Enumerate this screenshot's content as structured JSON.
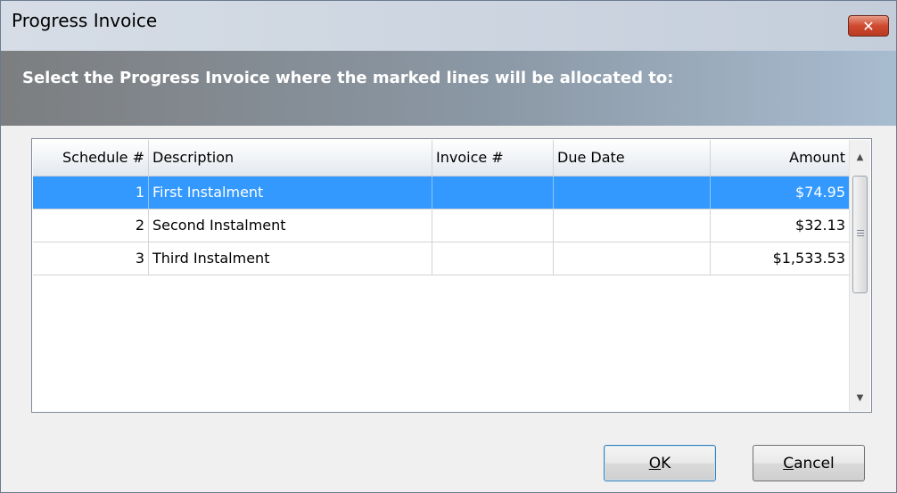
{
  "window": {
    "title": "Progress Invoice",
    "close_icon": "close-x-icon"
  },
  "banner": {
    "text": "Select the Progress Invoice where the marked lines will be allocated to:"
  },
  "table": {
    "columns": [
      "Schedule #",
      "Description",
      "Invoice #",
      "Due Date",
      "Amount"
    ],
    "rows": [
      {
        "schedule": "1",
        "description": "First Instalment",
        "invoice": "",
        "due_date": "",
        "amount": "$74.95",
        "selected": true
      },
      {
        "schedule": "2",
        "description": "Second Instalment",
        "invoice": "",
        "due_date": "",
        "amount": "$32.13",
        "selected": false
      },
      {
        "schedule": "3",
        "description": "Third Instalment",
        "invoice": "",
        "due_date": "",
        "amount": "$1,533.53",
        "selected": false
      }
    ]
  },
  "buttons": {
    "ok_mnemonic": "O",
    "ok_rest": "K",
    "cancel_mnemonic": "C",
    "cancel_rest": "ancel"
  },
  "colors": {
    "selection": "#3399ff",
    "close_button": "#cf4a30"
  }
}
